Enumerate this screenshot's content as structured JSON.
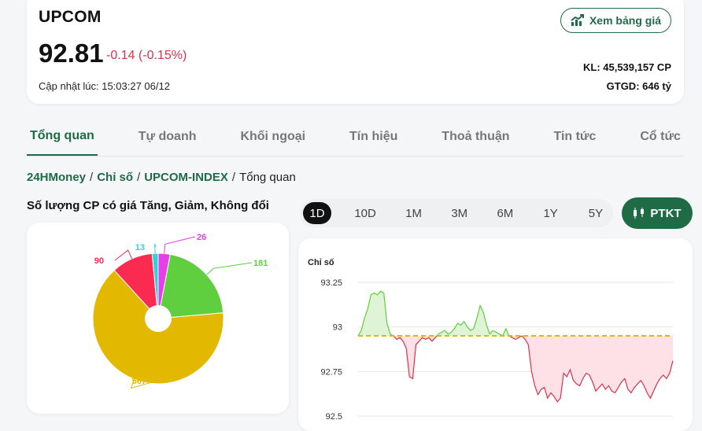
{
  "quote": {
    "name": "UPCOM",
    "price": "92.81",
    "change": "-0.14 (-0.15%)",
    "updated": "Cập nhật lúc: 15:03:27 06/12",
    "view_board_label": "Xem bảng giá",
    "volume": "KL: 45,539,157 CP",
    "value": "GTGD: 646 tỷ"
  },
  "tabs": [
    "Tổng quan",
    "Tự doanh",
    "Khối ngoại",
    "Tín hiệu",
    "Thoả thuận",
    "Tin tức",
    "Cổ tức"
  ],
  "breadcrumb": {
    "home": "24HMoney",
    "sep1": "/",
    "item1": "Chỉ số",
    "sep2": "/",
    "item2": "UPCOM-INDEX",
    "sep3": "/",
    "current": "Tổng quan"
  },
  "pie_section": {
    "title": "Số lượng CP có giá Tăng, Giảm, Không đổi"
  },
  "ranges": [
    "1D",
    "10D",
    "1M",
    "3M",
    "6M",
    "1Y",
    "5Y"
  ],
  "active_range": "1D",
  "ptkt_label": "PTKT",
  "colors": {
    "brand": "#1e6b45",
    "down": "#e0314b",
    "up": "#5fcf3f",
    "unchanged": "#e3b900",
    "ceiling": "#e43fe8",
    "floor": "#36d1d6",
    "reference": "#e3b900"
  },
  "chart_data": [
    {
      "type": "pie",
      "title": "Số lượng CP có giá Tăng, Giảm, Không đổi",
      "slices": [
        {
          "value": 26,
          "label": "26",
          "color": "#e43fe8"
        },
        {
          "value": 181,
          "label": "181",
          "color": "#5fcf3f"
        },
        {
          "value": 567,
          "label": "567",
          "color": "#e3b900"
        },
        {
          "value": 90,
          "label": "90",
          "color": "#fa2a50"
        },
        {
          "value": 13,
          "label": "13",
          "color": "#36d1d6"
        }
      ]
    },
    {
      "type": "area",
      "ylabel": "Chỉ số",
      "ylim": [
        92.5,
        93.25
      ],
      "yticks": [
        93.25,
        93,
        92.75,
        92.5
      ],
      "reference": 92.95,
      "values": [
        92.95,
        92.98,
        93.05,
        93.1,
        93.18,
        93.19,
        93.18,
        93.2,
        93.19,
        93.02,
        92.96,
        92.95,
        92.93,
        92.94,
        92.92,
        92.88,
        92.72,
        92.71,
        92.9,
        92.92,
        92.94,
        92.93,
        92.94,
        92.92,
        92.94,
        92.96,
        92.97,
        92.98,
        92.96,
        92.97,
        92.99,
        93.02,
        93.01,
        93.03,
        93.0,
        92.98,
        92.99,
        93.05,
        93.12,
        93.08,
        93.01,
        92.96,
        92.98,
        92.97,
        92.96,
        92.95,
        92.99,
        92.95,
        92.94,
        92.93,
        92.94,
        92.95,
        92.93,
        92.9,
        92.75,
        92.67,
        92.62,
        92.65,
        92.66,
        92.6,
        92.63,
        92.61,
        92.58,
        92.6,
        92.74,
        92.72,
        92.76,
        92.7,
        92.68,
        92.67,
        92.71,
        92.74,
        92.73,
        92.69,
        92.64,
        92.66,
        92.68,
        92.65,
        92.67,
        92.64,
        92.63,
        92.66,
        92.69,
        92.71,
        92.65,
        92.63,
        92.66,
        92.68,
        92.7,
        92.67,
        92.63,
        92.6,
        92.64,
        92.68,
        92.71,
        92.73,
        92.71,
        92.74,
        92.81
      ]
    }
  ]
}
